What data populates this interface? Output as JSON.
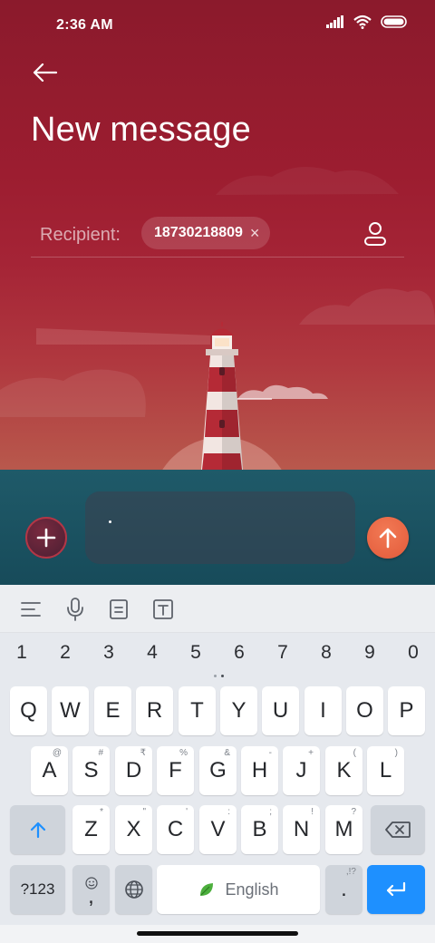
{
  "status_bar": {
    "time": "2:36 AM",
    "icons": [
      "signal-icon",
      "wifi-icon",
      "battery-icon"
    ]
  },
  "header": {
    "back_icon": "arrow-left-icon",
    "title": "New message"
  },
  "recipient": {
    "label": "Recipient:",
    "chips": [
      {
        "value": "18730218809",
        "remove": "×"
      }
    ],
    "contact_icon": "contact-person-icon"
  },
  "compose": {
    "attach_icon": "plus-icon",
    "message_text": "",
    "send_icon": "arrow-up-icon"
  },
  "keyboard_toolbar": {
    "tools": [
      "menu-lines-icon",
      "microphone-icon",
      "clipboard-icon",
      "text-format-icon"
    ]
  },
  "keyboard": {
    "numbers": [
      "1",
      "2",
      "3",
      "4",
      "5",
      "6",
      "7",
      "8",
      "9",
      "0"
    ],
    "row1": [
      "Q",
      "W",
      "E",
      "R",
      "T",
      "Y",
      "U",
      "I",
      "O",
      "P"
    ],
    "row2": [
      {
        "key": "A",
        "hint": "@"
      },
      {
        "key": "S",
        "hint": "#"
      },
      {
        "key": "D",
        "hint": "₹"
      },
      {
        "key": "F",
        "hint": "%"
      },
      {
        "key": "G",
        "hint": "&"
      },
      {
        "key": "H",
        "hint": "-"
      },
      {
        "key": "J",
        "hint": "+"
      },
      {
        "key": "K",
        "hint": "("
      },
      {
        "key": "L",
        "hint": ")"
      }
    ],
    "row3": [
      {
        "key": "Z",
        "hint": "*"
      },
      {
        "key": "X",
        "hint": "\""
      },
      {
        "key": "C",
        "hint": "'"
      },
      {
        "key": "V",
        "hint": ":"
      },
      {
        "key": "B",
        "hint": ";"
      },
      {
        "key": "N",
        "hint": "!"
      },
      {
        "key": "M",
        "hint": "?"
      }
    ],
    "symbols_key": "?123",
    "comma_key": ",",
    "space_label": "English",
    "period_key": ".",
    "period_hint": ",!?",
    "colors": {
      "enter_key": "#1e90ff",
      "shift_icon": "#1e90ff",
      "accent_red": "#a52436",
      "send_button": "#e85f3e"
    }
  }
}
